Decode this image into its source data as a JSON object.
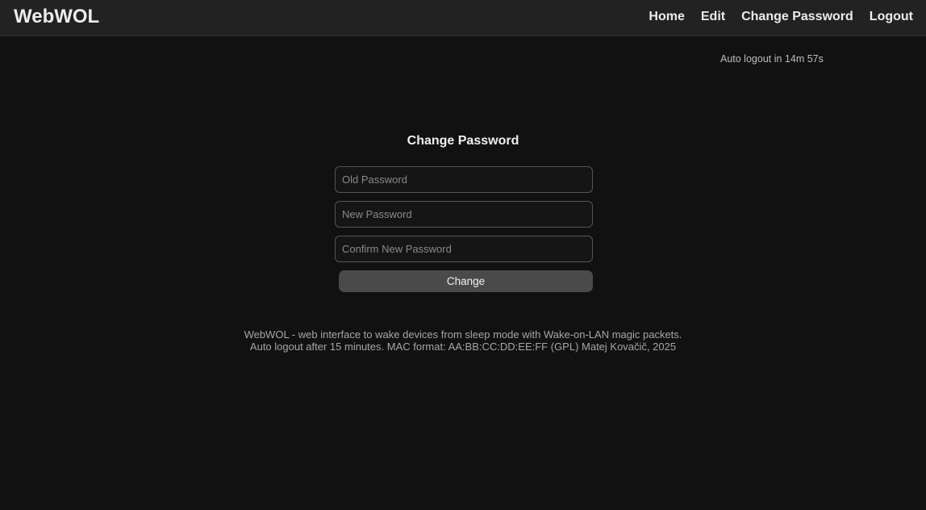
{
  "header": {
    "brand": "WebWOL",
    "nav": {
      "home": "Home",
      "edit": "Edit",
      "change_password": "Change Password",
      "logout": "Logout"
    }
  },
  "session": {
    "timer_text": "Auto logout in 14m 57s"
  },
  "form": {
    "title": "Change Password",
    "old_password_placeholder": "Old Password",
    "new_password_placeholder": "New Password",
    "confirm_password_placeholder": "Confirm New Password",
    "submit_label": "Change"
  },
  "footer": {
    "line1": "WebWOL - web interface to wake devices from sleep mode with Wake-on-LAN magic packets.",
    "line2": "Auto logout after 15 minutes. MAC format: AA:BB:CC:DD:EE:FF (GPL) Matej Kovačič, 2025"
  },
  "colors": {
    "background": "#111111",
    "header_background": "#222222",
    "button_background": "#4a4a4a",
    "field_border": "#555555"
  }
}
